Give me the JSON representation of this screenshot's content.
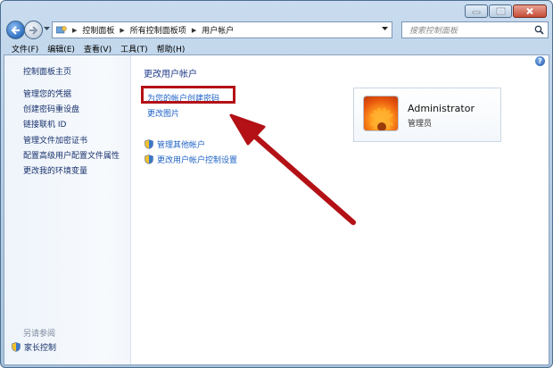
{
  "window": {
    "caption": {
      "minimize": "minimize-icon",
      "maximize": "maximize-icon",
      "close": "close-icon"
    }
  },
  "address": {
    "crumbs": [
      "控制面板",
      "所有控制面板项",
      "用户帐户"
    ],
    "search_placeholder": "搜索控制面板"
  },
  "menu": [
    "文件(F)",
    "编辑(E)",
    "查看(V)",
    "工具(T)",
    "帮助(H)"
  ],
  "sidebar": {
    "home": "控制面板主页",
    "links": [
      "管理您的凭据",
      "创建密码重设盘",
      "链接联机 ID",
      "管理文件加密证书",
      "配置高级用户配置文件属性",
      "更改我的环境变量"
    ],
    "see_also": "另请参阅",
    "parental": "家长控制"
  },
  "main": {
    "title": "更改用户帐户",
    "links": [
      "为您的帐户创建密码",
      "更改图片"
    ],
    "shield_links": [
      "管理其他帐户",
      "更改用户帐户控制设置"
    ]
  },
  "account": {
    "name": "Administrator",
    "role": "管理员"
  },
  "help": "?",
  "colors": {
    "highlight": "#b31116",
    "link": "#1e62c6",
    "title": "#1e3a8a"
  }
}
